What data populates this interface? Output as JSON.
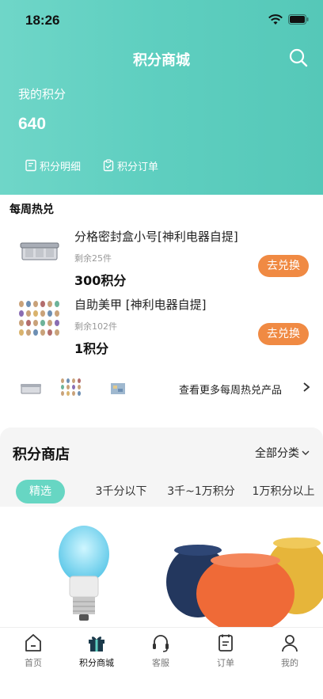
{
  "status_bar": {
    "time": "18:26"
  },
  "header": {
    "title": "积分商城",
    "points_label": "我的积分",
    "points_value": "640",
    "link_detail": "积分明细",
    "link_order": "积分订单"
  },
  "weekly": {
    "title": "每周热兑",
    "items": [
      {
        "name": "分格密封盒小号[神利电器自提]",
        "stock": "剩余25件",
        "price": "300积分",
        "button": "去兑换"
      },
      {
        "name": "自助美甲 [神利电器自提]",
        "stock": "剩余102件",
        "price": "1积分",
        "button": "去兑换"
      }
    ],
    "more_text": "查看更多每周热兑产品"
  },
  "shop": {
    "title": "积分商店",
    "category": "全部分类",
    "tabs": [
      "精选",
      "3千分以下",
      "3千~1万积分",
      "1万积分以上"
    ]
  },
  "tabbar": {
    "items": [
      "首页",
      "积分商城",
      "客服",
      "订单",
      "我的"
    ]
  },
  "colors": {
    "accent": "#5fcfc0",
    "button_orange": "#f08a43",
    "tab_active": "#67d6c3"
  }
}
